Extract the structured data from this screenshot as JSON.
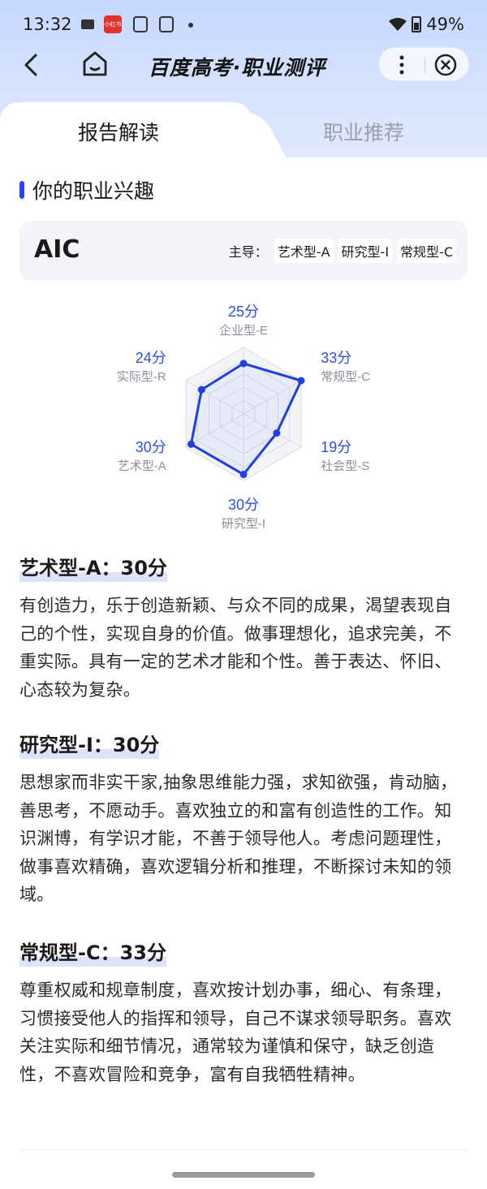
{
  "status_bar": {
    "time": "13:32",
    "battery": "49%",
    "red_icon_label": "小红书"
  },
  "nav": {
    "title": "百度高考·职业测评"
  },
  "tabs": [
    {
      "label": "报告解读",
      "active": true
    },
    {
      "label": "职业推荐",
      "active": false
    }
  ],
  "section": {
    "title": "你的职业兴趣"
  },
  "summary": {
    "code": "AIC",
    "leading_label": "主导：",
    "leading_types": [
      "艺术型-A",
      "研究型-I",
      "常规型-C"
    ]
  },
  "chart_data": {
    "type": "radar",
    "categories": [
      "企业型-E",
      "常规型-C",
      "社会型-S",
      "研究型-I",
      "艺术型-A",
      "实际型-R"
    ],
    "values": [
      25,
      33,
      19,
      30,
      30,
      24
    ],
    "value_labels": [
      "25分",
      "33分",
      "19分",
      "30分",
      "30分",
      "24分"
    ],
    "rmax": 33,
    "colors": {
      "series": "#1f3fe6",
      "grid": "#d9dbe2",
      "fill": "#f2f4f8",
      "score": "#2f4fe0",
      "label": "#8a8f9a"
    }
  },
  "traits": [
    {
      "title": "艺术型-A：30分",
      "desc": "有创造力，乐于创造新颖、与众不同的成果，渴望表现自己的个性，实现自身的价值。做事理想化，追求完美，不重实际。具有一定的艺术才能和个性。善于表达、怀旧、心态较为复杂。"
    },
    {
      "title": "研究型-I：30分",
      "desc": "思想家而非实干家,抽象思维能力强，求知欲强，肯动脑，善思考，不愿动手。喜欢独立的和富有创造性的工作。知识渊博，有学识才能，不善于领导他人。考虑问题理性，做事喜欢精确，喜欢逻辑分析和推理，不断探讨未知的领域。"
    },
    {
      "title": "常规型-C：33分",
      "desc": "尊重权威和规章制度，喜欢按计划办事，细心、有条理，习惯接受他人的指挥和领导，自己不谋求领导职务。喜欢关注实际和细节情况，通常较为谨慎和保守，缺乏创造性，不喜欢冒险和竞争，富有自我牺牲精神。"
    }
  ]
}
